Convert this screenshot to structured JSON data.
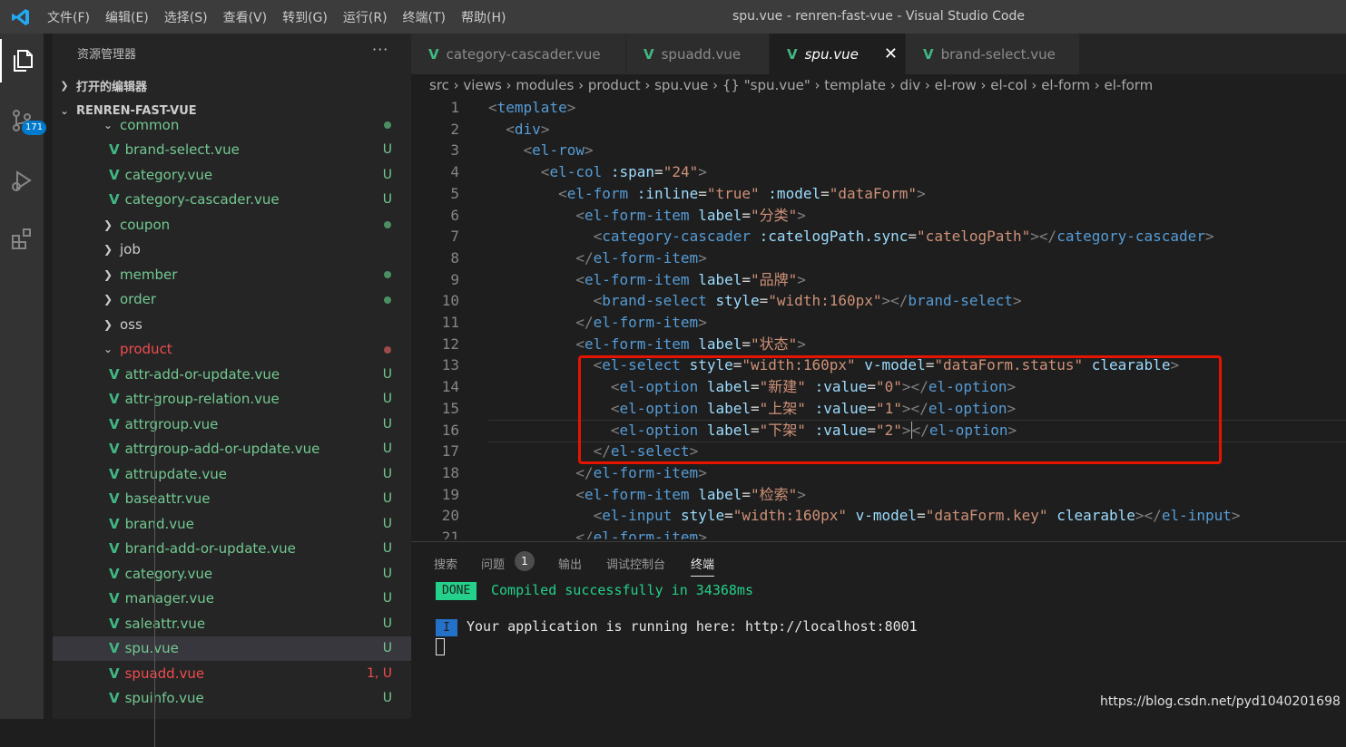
{
  "window": {
    "title": "spu.vue - renren-fast-vue - Visual Studio Code",
    "menu": [
      "文件(F)",
      "编辑(E)",
      "选择(S)",
      "查看(V)",
      "转到(G)",
      "运行(R)",
      "终端(T)",
      "帮助(H)"
    ]
  },
  "activity_bar": {
    "items": [
      "explorer-icon",
      "source-control-icon",
      "run-debug-icon",
      "extensions-icon"
    ],
    "scm_badge": "171"
  },
  "sidebar": {
    "title": "资源管理器",
    "more": "···",
    "open_editors": "打开的编辑器",
    "project": "RENREN-FAST-VUE",
    "tree": [
      {
        "label": "common",
        "type": "folder-open",
        "color": "#73c991",
        "status": "dot-green"
      },
      {
        "label": "brand-select.vue",
        "type": "vue",
        "color": "#73c991",
        "status": "U"
      },
      {
        "label": "category.vue",
        "type": "vue",
        "color": "#73c991",
        "status": "U"
      },
      {
        "label": "category-cascader.vue",
        "type": "vue",
        "color": "#73c991",
        "status": "U"
      },
      {
        "label": "coupon",
        "type": "folder",
        "color": "#73c991",
        "status": "dot-green"
      },
      {
        "label": "job",
        "type": "folder",
        "color": "#cccccc",
        "status": ""
      },
      {
        "label": "member",
        "type": "folder",
        "color": "#73c991",
        "status": "dot-green"
      },
      {
        "label": "order",
        "type": "folder",
        "color": "#73c991",
        "status": "dot-green"
      },
      {
        "label": "oss",
        "type": "folder",
        "color": "#cccccc",
        "status": ""
      },
      {
        "label": "product",
        "type": "folder-open",
        "color": "#f14c4c",
        "status": "dot-red"
      },
      {
        "label": "attr-add-or-update.vue",
        "type": "vue",
        "color": "#73c991",
        "status": "U"
      },
      {
        "label": "attr-group-relation.vue",
        "type": "vue",
        "color": "#73c991",
        "status": "U"
      },
      {
        "label": "attrgroup.vue",
        "type": "vue",
        "color": "#73c991",
        "status": "U"
      },
      {
        "label": "attrgroup-add-or-update.vue",
        "type": "vue",
        "color": "#73c991",
        "status": "U"
      },
      {
        "label": "attrupdate.vue",
        "type": "vue",
        "color": "#73c991",
        "status": "U"
      },
      {
        "label": "baseattr.vue",
        "type": "vue",
        "color": "#73c991",
        "status": "U"
      },
      {
        "label": "brand.vue",
        "type": "vue",
        "color": "#73c991",
        "status": "U"
      },
      {
        "label": "brand-add-or-update.vue",
        "type": "vue",
        "color": "#73c991",
        "status": "U"
      },
      {
        "label": "category.vue",
        "type": "vue",
        "color": "#73c991",
        "status": "U"
      },
      {
        "label": "manager.vue",
        "type": "vue",
        "color": "#73c991",
        "status": "U"
      },
      {
        "label": "saleattr.vue",
        "type": "vue",
        "color": "#73c991",
        "status": "U"
      },
      {
        "label": "spu.vue",
        "type": "vue",
        "color": "#73c991",
        "status": "U",
        "selected": true
      },
      {
        "label": "spuadd.vue",
        "type": "vue",
        "color": "#f14c4c",
        "status": "1, U"
      },
      {
        "label": "spuinfo.vue",
        "type": "vue",
        "color": "#73c991",
        "status": "U"
      }
    ]
  },
  "tabs": [
    {
      "label": "category-cascader.vue",
      "active": false
    },
    {
      "label": "spuadd.vue",
      "active": false
    },
    {
      "label": "spu.vue",
      "active": true,
      "close": "✕"
    },
    {
      "label": "brand-select.vue",
      "active": false
    }
  ],
  "breadcrumb": "src › views › modules › product › spu.vue › {} \"spu.vue\" › template › div › el-row › el-col › el-form › el-form",
  "code": [
    {
      "n": "1",
      "tokens": [
        [
          "t",
          "<"
        ],
        [
          "tg",
          "template"
        ],
        [
          "t",
          ">"
        ]
      ]
    },
    {
      "n": "2",
      "tokens": [
        [
          "tx",
          "  "
        ],
        [
          "t",
          "<"
        ],
        [
          "tg",
          "div"
        ],
        [
          "t",
          ">"
        ]
      ]
    },
    {
      "n": "3",
      "tokens": [
        [
          "tx",
          "    "
        ],
        [
          "t",
          "<"
        ],
        [
          "tg",
          "el-row"
        ],
        [
          "t",
          ">"
        ]
      ]
    },
    {
      "n": "4",
      "tokens": [
        [
          "tx",
          "      "
        ],
        [
          "t",
          "<"
        ],
        [
          "tg",
          "el-col"
        ],
        [
          "tx",
          " "
        ],
        [
          "at",
          ":span"
        ],
        [
          "tx",
          "="
        ],
        [
          "st",
          "\"24\""
        ],
        [
          "t",
          ">"
        ]
      ]
    },
    {
      "n": "5",
      "tokens": [
        [
          "tx",
          "        "
        ],
        [
          "t",
          "<"
        ],
        [
          "tg",
          "el-form"
        ],
        [
          "tx",
          " "
        ],
        [
          "at",
          ":inline"
        ],
        [
          "tx",
          "="
        ],
        [
          "st",
          "\"true\""
        ],
        [
          "tx",
          " "
        ],
        [
          "at",
          ":model"
        ],
        [
          "tx",
          "="
        ],
        [
          "st",
          "\"dataForm\""
        ],
        [
          "t",
          ">"
        ]
      ]
    },
    {
      "n": "6",
      "tokens": [
        [
          "tx",
          "          "
        ],
        [
          "t",
          "<"
        ],
        [
          "tg",
          "el-form-item"
        ],
        [
          "tx",
          " "
        ],
        [
          "at",
          "label"
        ],
        [
          "tx",
          "="
        ],
        [
          "st",
          "\"分类\""
        ],
        [
          "t",
          ">"
        ]
      ]
    },
    {
      "n": "7",
      "tokens": [
        [
          "tx",
          "            "
        ],
        [
          "t",
          "<"
        ],
        [
          "tg",
          "category-cascader"
        ],
        [
          "tx",
          " "
        ],
        [
          "at",
          ":catelogPath.sync"
        ],
        [
          "tx",
          "="
        ],
        [
          "st",
          "\"catelogPath\""
        ],
        [
          "t",
          "></"
        ],
        [
          "tg",
          "category-cascader"
        ],
        [
          "t",
          ">"
        ]
      ]
    },
    {
      "n": "8",
      "tokens": [
        [
          "tx",
          "          "
        ],
        [
          "t",
          "</"
        ],
        [
          "tg",
          "el-form-item"
        ],
        [
          "t",
          ">"
        ]
      ]
    },
    {
      "n": "9",
      "tokens": [
        [
          "tx",
          "          "
        ],
        [
          "t",
          "<"
        ],
        [
          "tg",
          "el-form-item"
        ],
        [
          "tx",
          " "
        ],
        [
          "at",
          "label"
        ],
        [
          "tx",
          "="
        ],
        [
          "st",
          "\"品牌\""
        ],
        [
          "t",
          ">"
        ]
      ]
    },
    {
      "n": "10",
      "tokens": [
        [
          "tx",
          "            "
        ],
        [
          "t",
          "<"
        ],
        [
          "tg",
          "brand-select"
        ],
        [
          "tx",
          " "
        ],
        [
          "at",
          "style"
        ],
        [
          "tx",
          "="
        ],
        [
          "st",
          "\"width:160px\""
        ],
        [
          "t",
          "></"
        ],
        [
          "tg",
          "brand-select"
        ],
        [
          "t",
          ">"
        ]
      ]
    },
    {
      "n": "11",
      "tokens": [
        [
          "tx",
          "          "
        ],
        [
          "t",
          "</"
        ],
        [
          "tg",
          "el-form-item"
        ],
        [
          "t",
          ">"
        ]
      ]
    },
    {
      "n": "12",
      "tokens": [
        [
          "tx",
          "          "
        ],
        [
          "t",
          "<"
        ],
        [
          "tg",
          "el-form-item"
        ],
        [
          "tx",
          " "
        ],
        [
          "at",
          "label"
        ],
        [
          "tx",
          "="
        ],
        [
          "st",
          "\"状态\""
        ],
        [
          "t",
          ">"
        ]
      ]
    },
    {
      "n": "13",
      "tokens": [
        [
          "tx",
          "            "
        ],
        [
          "t",
          "<"
        ],
        [
          "tg",
          "el-select"
        ],
        [
          "tx",
          " "
        ],
        [
          "at",
          "style"
        ],
        [
          "tx",
          "="
        ],
        [
          "st",
          "\"width:160px\""
        ],
        [
          "tx",
          " "
        ],
        [
          "at",
          "v-model"
        ],
        [
          "tx",
          "="
        ],
        [
          "st",
          "\"dataForm.status\""
        ],
        [
          "tx",
          " "
        ],
        [
          "at",
          "clearable"
        ],
        [
          "t",
          ">"
        ]
      ]
    },
    {
      "n": "14",
      "tokens": [
        [
          "tx",
          "              "
        ],
        [
          "t",
          "<"
        ],
        [
          "tg",
          "el-option"
        ],
        [
          "tx",
          " "
        ],
        [
          "at",
          "label"
        ],
        [
          "tx",
          "="
        ],
        [
          "st",
          "\"新建\""
        ],
        [
          "tx",
          " "
        ],
        [
          "at",
          ":value"
        ],
        [
          "tx",
          "="
        ],
        [
          "st",
          "\"0\""
        ],
        [
          "t",
          "></"
        ],
        [
          "tg",
          "el-option"
        ],
        [
          "t",
          ">"
        ]
      ]
    },
    {
      "n": "15",
      "tokens": [
        [
          "tx",
          "              "
        ],
        [
          "t",
          "<"
        ],
        [
          "tg",
          "el-option"
        ],
        [
          "tx",
          " "
        ],
        [
          "at",
          "label"
        ],
        [
          "tx",
          "="
        ],
        [
          "st",
          "\"上架\""
        ],
        [
          "tx",
          " "
        ],
        [
          "at",
          ":value"
        ],
        [
          "tx",
          "="
        ],
        [
          "st",
          "\"1\""
        ],
        [
          "t",
          "></"
        ],
        [
          "tg",
          "el-option"
        ],
        [
          "t",
          ">"
        ]
      ]
    },
    {
      "n": "16",
      "tokens": [
        [
          "tx",
          "              "
        ],
        [
          "t",
          "<"
        ],
        [
          "tg",
          "el-option"
        ],
        [
          "tx",
          " "
        ],
        [
          "at",
          "label"
        ],
        [
          "tx",
          "="
        ],
        [
          "st",
          "\"下架\""
        ],
        [
          "tx",
          " "
        ],
        [
          "at",
          ":value"
        ],
        [
          "tx",
          "="
        ],
        [
          "st",
          "\"2\""
        ],
        [
          "t",
          ">"
        ],
        [
          "cur",
          "</"
        ],
        [
          "tg",
          "el-option"
        ],
        [
          "t",
          ">"
        ]
      ]
    },
    {
      "n": "17",
      "tokens": [
        [
          "tx",
          "            "
        ],
        [
          "t",
          "</"
        ],
        [
          "tg",
          "el-select"
        ],
        [
          "t",
          ">"
        ]
      ]
    },
    {
      "n": "18",
      "tokens": [
        [
          "tx",
          "          "
        ],
        [
          "t",
          "</"
        ],
        [
          "tg",
          "el-form-item"
        ],
        [
          "t",
          ">"
        ]
      ]
    },
    {
      "n": "19",
      "tokens": [
        [
          "tx",
          "          "
        ],
        [
          "t",
          "<"
        ],
        [
          "tg",
          "el-form-item"
        ],
        [
          "tx",
          " "
        ],
        [
          "at",
          "label"
        ],
        [
          "tx",
          "="
        ],
        [
          "st",
          "\"检索\""
        ],
        [
          "t",
          ">"
        ]
      ]
    },
    {
      "n": "20",
      "tokens": [
        [
          "tx",
          "            "
        ],
        [
          "t",
          "<"
        ],
        [
          "tg",
          "el-input"
        ],
        [
          "tx",
          " "
        ],
        [
          "at",
          "style"
        ],
        [
          "tx",
          "="
        ],
        [
          "st",
          "\"width:160px\""
        ],
        [
          "tx",
          " "
        ],
        [
          "at",
          "v-model"
        ],
        [
          "tx",
          "="
        ],
        [
          "st",
          "\"dataForm.key\""
        ],
        [
          "tx",
          " "
        ],
        [
          "at",
          "clearable"
        ],
        [
          "t",
          "></"
        ],
        [
          "tg",
          "el-input"
        ],
        [
          "t",
          ">"
        ]
      ]
    },
    {
      "n": "21",
      "tokens": [
        [
          "tx",
          "          "
        ],
        [
          "t",
          "</"
        ],
        [
          "tg",
          "el-form-item"
        ],
        [
          "t",
          ">"
        ]
      ]
    }
  ],
  "panel": {
    "tabs": [
      "搜索",
      "问题",
      "输出",
      "调试控制台",
      "终端"
    ],
    "problems_count": "1",
    "active_tab": "终端",
    "done_label": "DONE",
    "done_text": "Compiled successfully in 34368ms",
    "info_label": "I",
    "info_text": "Your application is running here: http://localhost:8001"
  },
  "watermark": "https://blog.csdn.net/pyd1040201698",
  "colors": {
    "vue_green": "#41b883",
    "accent": "#007acc",
    "red_box": "#e51400",
    "done_green": "#23d18b"
  }
}
